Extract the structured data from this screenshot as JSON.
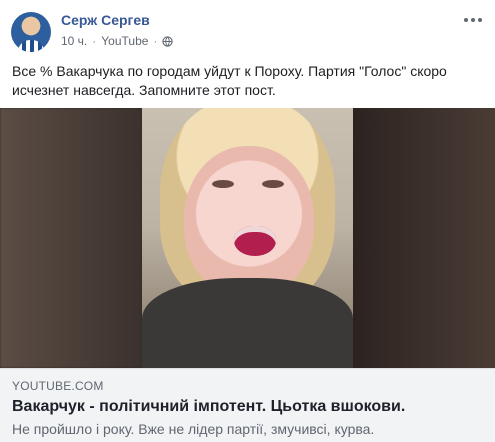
{
  "post": {
    "author": "Серж Сергев",
    "time": "10 ч.",
    "source": "YouTube",
    "separator": "·",
    "text": "Все % Вакарчука по городам уйдут к Пороху. Партия \"Голос\" скоро исчезнет навсегда. Запомните этот пост."
  },
  "link": {
    "domain": "YOUTUBE.COM",
    "title": "Вакарчук - політичний імпотент. Цьотка вшокови.",
    "description": "Не пройшло і року. Вже не лідер партії, змучивсі, курва."
  },
  "icons": {
    "privacy": "globe-icon",
    "menu": "more-options-icon"
  }
}
